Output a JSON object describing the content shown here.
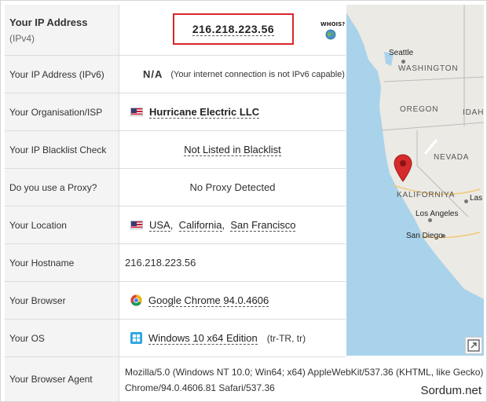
{
  "rows": [
    {
      "label": "Your IP Address",
      "sublabel": "(IPv4)",
      "value": "216.218.223.56",
      "whois": "WHOIS?"
    },
    {
      "label": "Your IP Address (IPv6)",
      "value": "N/A",
      "note": "(Your internet connection is not IPv6 capable)"
    },
    {
      "label": "Your Organisation/ISP",
      "value": "Hurricane Electric LLC"
    },
    {
      "label": "Your IP Blacklist Check",
      "value": "Not Listed in Blacklist"
    },
    {
      "label": "Do you use a Proxy?",
      "value": "No Proxy Detected"
    },
    {
      "label": "Your Location",
      "country": "USA",
      "region": "California",
      "city": "San Francisco"
    },
    {
      "label": "Your Hostname",
      "value": "216.218.223.56"
    },
    {
      "label": "Your Browser",
      "value": "Google Chrome 94.0.4606"
    },
    {
      "label": "Your OS",
      "value": "Windows 10 x64 Edition",
      "locale": "(tr-TR, tr)"
    },
    {
      "label": "Your Browser Agent",
      "line1": "Mozilla/5.0 (Windows NT 10.0; Win64; x64) AppleWebKit/537.36 (KHTML, like Gecko)",
      "line2": "Chrome/94.0.4606.81 Safari/537.36"
    }
  ],
  "map": {
    "states": [
      "WASHINGTON",
      "OREGON",
      "IDAHO",
      "NEVADA",
      "KALIFORNIYA"
    ],
    "cities": [
      "Seattle",
      "Las",
      "Los Angeles",
      "San Diego"
    ]
  },
  "watermark": "Sordum.net",
  "colors": {
    "highlight_border": "#d9262c",
    "map_water": "#a9d3ea",
    "map_land": "#eceae4",
    "pin": "#d62b2b"
  }
}
